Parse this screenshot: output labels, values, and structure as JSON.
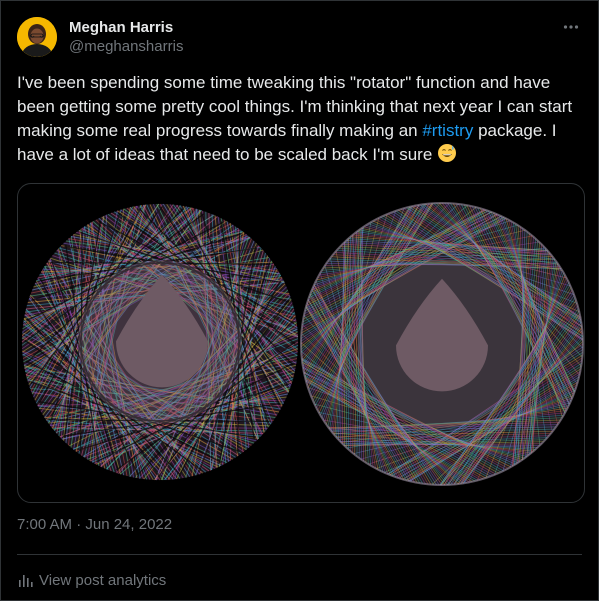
{
  "author": {
    "display_name": "Meghan Harris",
    "handle": "@meghansharris"
  },
  "post": {
    "text_before_hashtag": "I've been spending some time tweaking this \"rotator\" function and have been getting some pretty cool things. I'm thinking that next year I can start making some real progress towards finally making an ",
    "hashtag": "#rtistry",
    "text_after_hashtag": " package. I have a lot of ideas that need to be scaled back I'm sure ",
    "emoji": "grinning-sweat-emoji",
    "timestamp": "7:00 AM · Jun 24, 2022"
  },
  "footer": {
    "analytics_label": "View post analytics"
  },
  "colors": {
    "background": "#000000",
    "text": "#e7e9ea",
    "muted": "#71767b",
    "link": "#1d9bf0",
    "border": "#2f3336",
    "inner_disk": "#6e5a64"
  },
  "icons": {
    "more": "more-horizontal-icon",
    "analytics": "bar-chart-icon"
  }
}
